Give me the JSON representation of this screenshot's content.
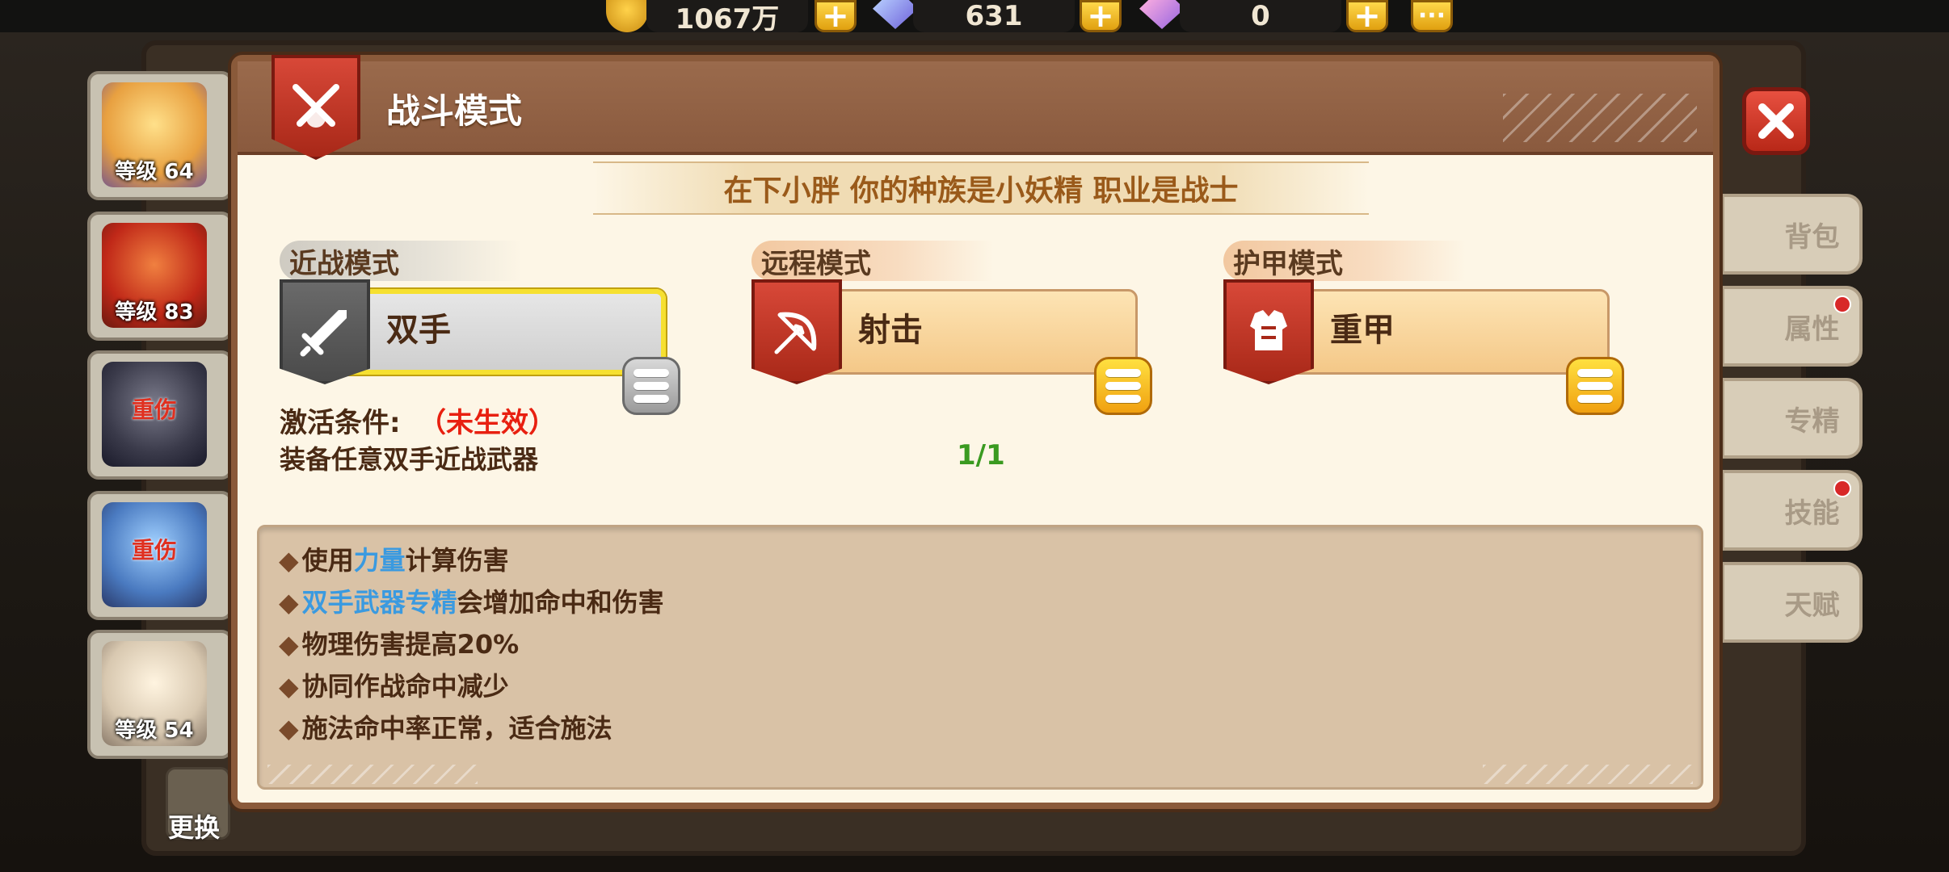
{
  "top_bar": {
    "coins": "1067万",
    "gems": "631",
    "pink_gems": "0",
    "more_label": "···"
  },
  "heroes": [
    {
      "level": "等级 64",
      "status": ""
    },
    {
      "level": "等级 83",
      "status": ""
    },
    {
      "level": "",
      "status": "重伤"
    },
    {
      "level": "",
      "status": "重伤"
    },
    {
      "level": "等级 54",
      "status": ""
    }
  ],
  "swap_label": "更换",
  "side_tabs": [
    "背包",
    "属性",
    "专精",
    "技能",
    "天赋"
  ],
  "dialog": {
    "title": "战斗模式",
    "subtitle": "在下小胖  你的种族是小妖精  职业是战士",
    "modes": [
      {
        "header": "近战模式",
        "value": "双手"
      },
      {
        "header": "远程模式",
        "value": "射击"
      },
      {
        "header": "护甲模式",
        "value": "重甲"
      }
    ],
    "condition": {
      "label": "激活条件:",
      "status": "（未生效）",
      "description": "装备任意双手近战武器",
      "progress": "1/1"
    },
    "effects": [
      {
        "pre": "使用",
        "hl": "力量",
        "post": "计算伤害"
      },
      {
        "pre": "",
        "hl": "双手武器专精",
        "post": "会增加命中和伤害"
      },
      {
        "pre": "物理伤害提高20%",
        "hl": "",
        "post": ""
      },
      {
        "pre": "协同作战命中减少",
        "hl": "",
        "post": ""
      },
      {
        "pre": "施法命中率正常，适合施法",
        "hl": "",
        "post": ""
      }
    ],
    "colors": {
      "highlight": "#3a9ae0",
      "inactive": "#e82010",
      "progress": "#3a9a20"
    }
  }
}
